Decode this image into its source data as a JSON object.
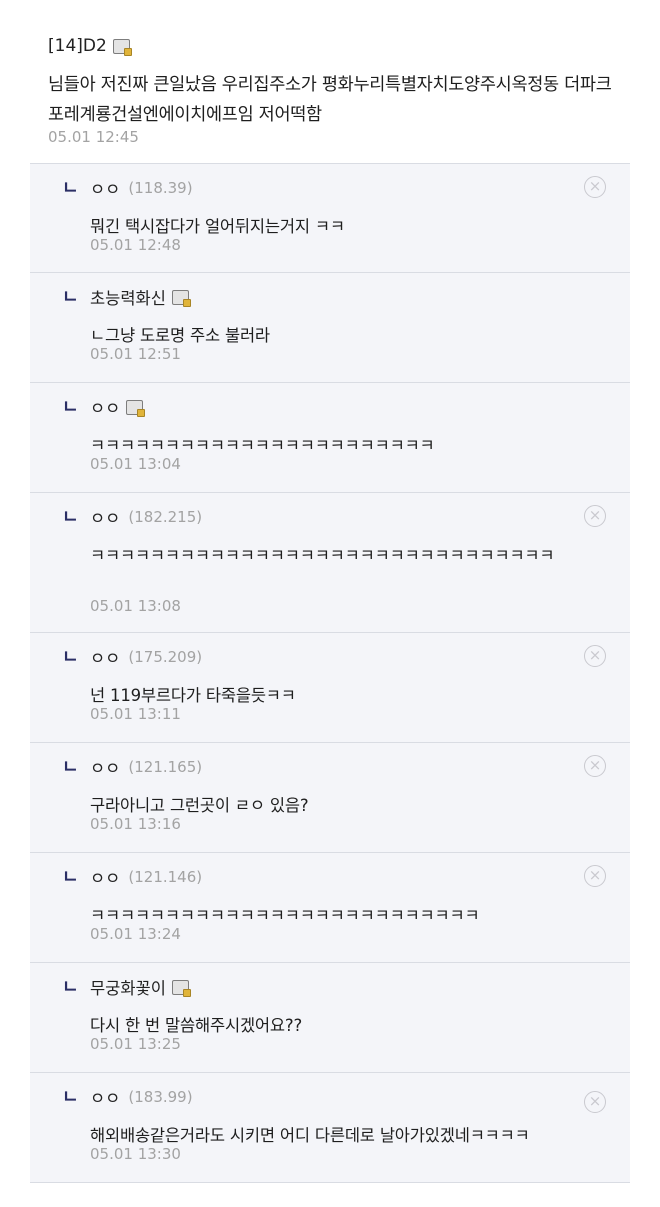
{
  "post": {
    "author": "[14]D2",
    "author_icon": "memo-icon",
    "body": "님들아 저진짜 큰일났음 우리집주소가 평화누리특별자치도양주시옥정동 더파크포레계룡건설엔에이치에프임 저어떡함",
    "time": "05.01 12:45"
  },
  "reply_arrow": "ㄴ",
  "replies": [
    {
      "name": "ㅇㅇ",
      "ip": "(118.39)",
      "text": "뭐긴 택시잡다가 얼어뒤지는거지 ㅋㅋ",
      "time": "05.01 12:48",
      "deletable": true
    },
    {
      "name": "초능력화신",
      "ip": "",
      "text": "ㄴ그냥 도로명 주소 불러라",
      "time": "05.01 12:51",
      "deletable": false
    },
    {
      "name": "ㅇㅇ",
      "ip": "",
      "text": "ㅋㅋㅋㅋㅋㅋㅋㅋㅋㅋㅋㅋㅋㅋㅋㅋㅋㅋㅋㅋㅋㅋㅋ",
      "time": "05.01 13:04",
      "deletable": false
    },
    {
      "name": "ㅇㅇ",
      "ip": "(182.215)",
      "text": "ㅋㅋㅋㅋㅋㅋㅋㅋㅋㅋㅋㅋㅋㅋㅋㅋㅋㅋㅋㅋㅋㅋㅋㅋㅋㅋㅋㅋㅋㅋㅋ",
      "time": "05.01 13:08",
      "deletable": true
    },
    {
      "name": "ㅇㅇ",
      "ip": "(175.209)",
      "text": "넌 119부르다가 타죽을듯ㅋㅋ",
      "time": "05.01 13:11",
      "deletable": true
    },
    {
      "name": "ㅇㅇ",
      "ip": "(121.165)",
      "text": "구라아니고 그런곳이 ㄹㅇ 있음?",
      "time": "05.01 13:16",
      "deletable": true
    },
    {
      "name": "ㅇㅇ",
      "ip": "(121.146)",
      "text": "ㅋㅋㅋㅋㅋㅋㅋㅋㅋㅋㅋㅋㅋㅋㅋㅋㅋㅋㅋㅋㅋㅋㅋㅋㅋㅋ",
      "time": "05.01 13:24",
      "deletable": true
    },
    {
      "name": "무궁화꽃이",
      "ip": "",
      "text": "다시 한 번 말씀해주시겠어요??",
      "time": "05.01 13:25",
      "deletable": false
    },
    {
      "name": "ㅇㅇ",
      "ip": "(183.99)",
      "text": "해외배송같은거라도 시키면 어디 다른데로 날아가있겠네ㅋㅋㅋㅋ",
      "time": "05.01 13:30",
      "deletable": true
    }
  ],
  "close_glyph": "×"
}
